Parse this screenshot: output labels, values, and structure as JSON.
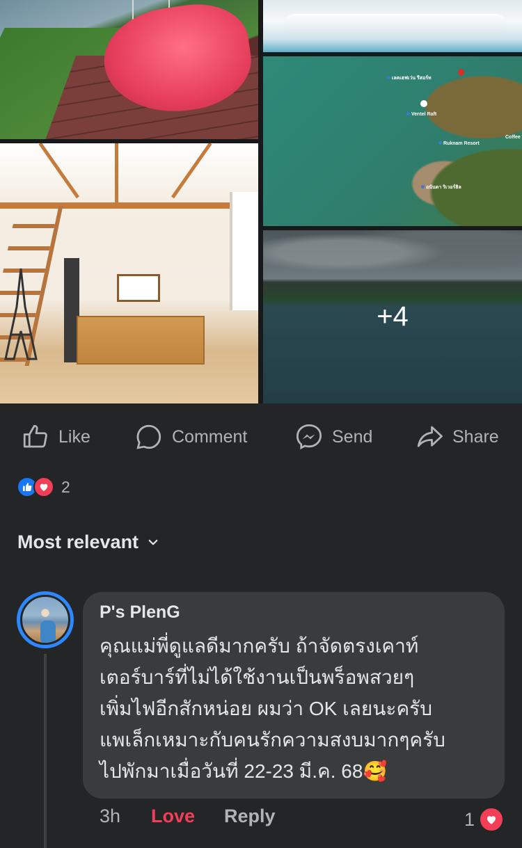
{
  "photos": {
    "more_count": "+4",
    "map_labels": [
      "เลคเฮฟเว่น รีสอร์ท",
      "Ventel Raft",
      "Ruknam Resort",
      "อนันตา ริเวอร์ฮิล",
      "Coffee"
    ]
  },
  "actions": [
    {
      "label": "Like",
      "icon": "thumbs-up-icon"
    },
    {
      "label": "Comment",
      "icon": "comment-icon"
    },
    {
      "label": "Send",
      "icon": "messenger-icon"
    },
    {
      "label": "Share",
      "icon": "share-icon"
    }
  ],
  "reactions": {
    "types": [
      "like",
      "love"
    ],
    "count": "2"
  },
  "sort": {
    "label": "Most relevant",
    "icon": "chevron-down-icon"
  },
  "comment": {
    "author": "P's PlenG",
    "lines": [
      "คุณแม่พี่ดูแลดีมากครับ ถ้าจัดตรงเคาท์",
      "เตอร์บาร์ที่ไม่ได้ใช้งานเป็นพร็อพสวยๆ",
      "เพิ่มไฟอีกสักหน่อย ผมว่า OK เลยนะครับ",
      "แพเล็กเหมาะกับคนรักความสงบมากๆครับ",
      "ไปพักมาเมื่อวันที่ 22-23 มี.ค. 68🥰"
    ],
    "time": "3h",
    "love_label": "Love",
    "reply_label": "Reply",
    "reaction_count": "1"
  },
  "colors": {
    "background": "#242526",
    "bubble": "#3a3b3c",
    "love": "#f33e58",
    "like": "#1877f2",
    "muted_text": "#b0b3b8"
  }
}
